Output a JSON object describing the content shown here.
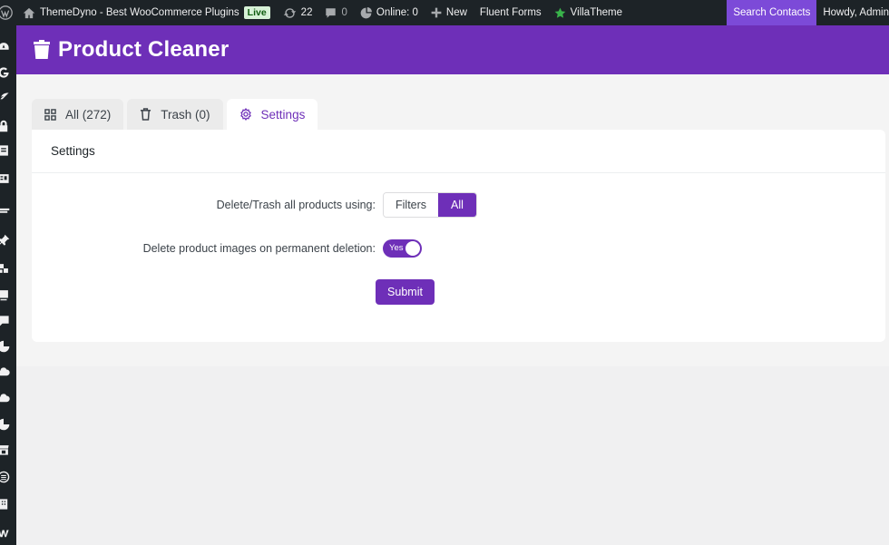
{
  "adminbar": {
    "site_name": "ThemeDyno - Best WooCommerce Plugins",
    "live_badge": "Live",
    "updates_count": "22",
    "comments_count": "0",
    "online_label": "Online: 0",
    "new_label": "New",
    "fluent_forms_label": "Fluent Forms",
    "villatheme_label": "VillaTheme",
    "search_contacts_label": "Search Contacts",
    "howdy_label": "Howdy, Admin"
  },
  "header": {
    "title": "Product Cleaner"
  },
  "tabs": [
    {
      "label": "All (272)",
      "icon": "grid-icon"
    },
    {
      "label": "Trash (0)",
      "icon": "trash-icon"
    },
    {
      "label": "Settings",
      "icon": "gear-icon",
      "active": true
    }
  ],
  "settings": {
    "heading": "Settings",
    "delete_mode_label": "Delete/Trash all products using",
    "delete_mode_options": [
      "Filters",
      "All"
    ],
    "delete_mode_selected": "All",
    "delete_images_label": "Delete product images on permanent deletion",
    "delete_images_value": "Yes",
    "submit_label": "Submit"
  },
  "colors": {
    "accent": "#6e2fb8",
    "adminbar": "#1d2327",
    "search_highlight": "#7c4ad8"
  }
}
